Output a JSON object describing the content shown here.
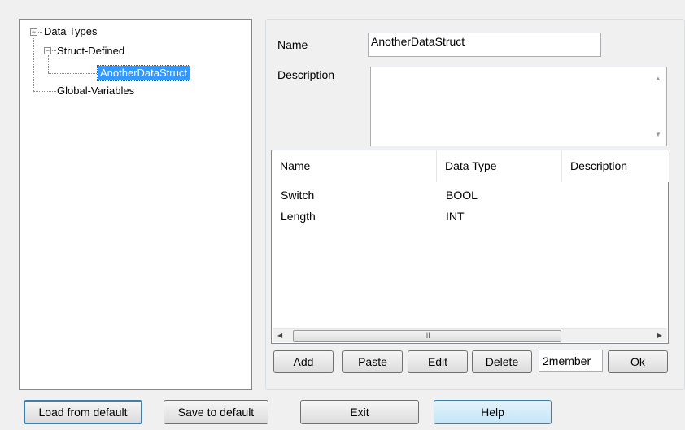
{
  "tree": {
    "root": "Data Types",
    "struct_defined": "Struct-Defined",
    "selected_struct": "AnotherDataStruct",
    "global_variables": "Global-Variables"
  },
  "form": {
    "name_label": "Name",
    "name_value": "AnotherDataStruct",
    "description_label": "Description",
    "description_value": ""
  },
  "members": {
    "columns": [
      "Name",
      "Data Type",
      "Description"
    ],
    "rows": [
      {
        "name": "Switch",
        "type": "BOOL",
        "description": ""
      },
      {
        "name": "Length",
        "type": "INT",
        "description": ""
      }
    ],
    "scroll_thumb_glyph": "III"
  },
  "member_buttons": {
    "add": "Add",
    "paste": "Paste",
    "edit": "Edit",
    "delete": "Delete",
    "count": "2member",
    "ok": "Ok"
  },
  "footer": {
    "load_default": "Load from default",
    "save_default": "Save to default",
    "exit": "Exit",
    "help": "Help"
  },
  "icons": {
    "collapse": "collapse-icon",
    "scroll_up": "scroll-up-icon",
    "scroll_down": "scroll-down-icon",
    "scroll_left": "scroll-left-icon",
    "scroll_right": "scroll-right-icon"
  },
  "colors": {
    "selection": "#3399ff",
    "window_bg": "#f0f0f0",
    "focus_border": "#3c7fb1"
  }
}
